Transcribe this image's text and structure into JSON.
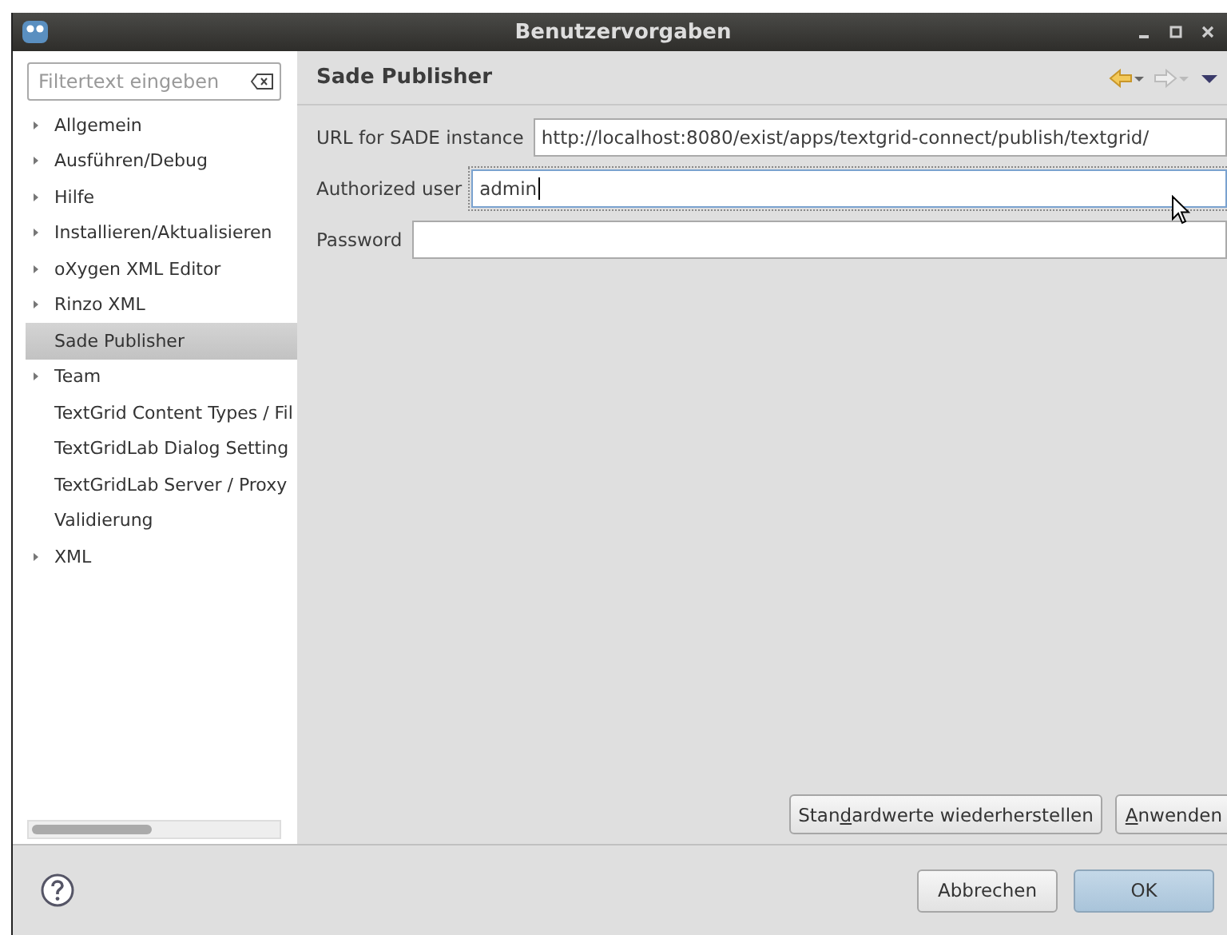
{
  "window": {
    "title": "Benutzervorgaben"
  },
  "filter": {
    "placeholder": "Filtertext eingeben"
  },
  "tree": [
    {
      "label": "Allgemein",
      "expandable": true,
      "selected": false
    },
    {
      "label": "Ausführen/Debug",
      "expandable": true,
      "selected": false
    },
    {
      "label": "Hilfe",
      "expandable": true,
      "selected": false
    },
    {
      "label": "Installieren/Aktualisieren",
      "expandable": true,
      "selected": false
    },
    {
      "label": "oXygen XML Editor",
      "expandable": true,
      "selected": false
    },
    {
      "label": "Rinzo XML",
      "expandable": true,
      "selected": false
    },
    {
      "label": "Sade Publisher",
      "expandable": false,
      "selected": true
    },
    {
      "label": "Team",
      "expandable": true,
      "selected": false
    },
    {
      "label": "TextGrid Content Types / Fil",
      "expandable": false,
      "selected": false
    },
    {
      "label": "TextGridLab Dialog Setting",
      "expandable": false,
      "selected": false
    },
    {
      "label": "TextGridLab Server / Proxy",
      "expandable": false,
      "selected": false
    },
    {
      "label": "Validierung",
      "expandable": false,
      "selected": false
    },
    {
      "label": "XML",
      "expandable": true,
      "selected": false
    }
  ],
  "page": {
    "title": "Sade Publisher",
    "fields": [
      {
        "label": "URL for SADE instance",
        "value": "http://localhost:8080/exist/apps/textgrid-connect/publish/textgrid/",
        "focused": false
      },
      {
        "label": "Authorized user",
        "value": "admin",
        "focused": true
      },
      {
        "label": "Password",
        "focused": false
      }
    ],
    "buttons": [
      {
        "before": "Stan",
        "mnemonic": "d",
        "after": "ardwerte wiederherstellen"
      },
      {
        "mnemonic": "A",
        "after": "nwenden"
      }
    ]
  },
  "footer": {
    "buttons": [
      {
        "label": "Abbrechen",
        "default": false
      },
      {
        "label": "OK",
        "default": true
      }
    ]
  }
}
